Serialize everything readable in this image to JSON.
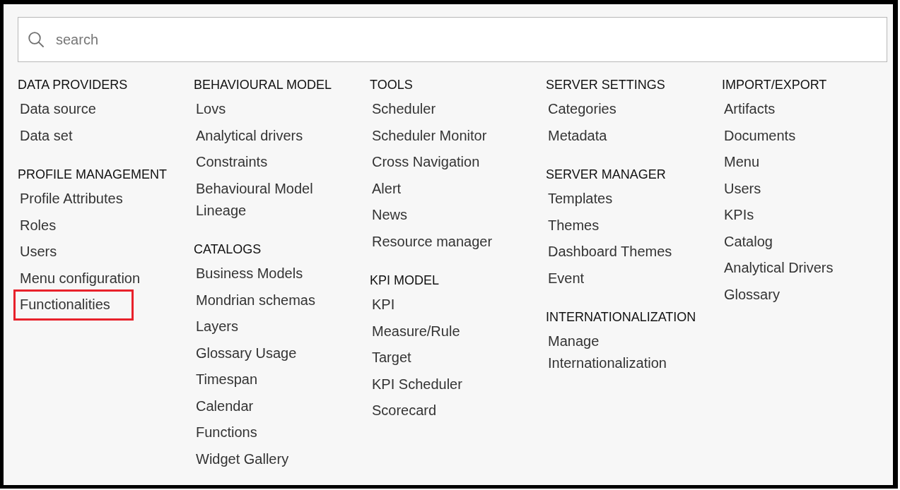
{
  "search": {
    "placeholder": "search"
  },
  "columns": [
    {
      "groups": [
        {
          "title": "DATA PROVIDERS",
          "items": [
            {
              "label": "Data source",
              "highlighted": false
            },
            {
              "label": "Data set",
              "highlighted": false
            }
          ]
        },
        {
          "title": "PROFILE MANAGEMENT",
          "items": [
            {
              "label": "Profile Attributes",
              "highlighted": false
            },
            {
              "label": "Roles",
              "highlighted": false
            },
            {
              "label": "Users",
              "highlighted": false
            },
            {
              "label": "Menu configuration",
              "highlighted": false
            },
            {
              "label": "Functionalities",
              "highlighted": true
            }
          ]
        }
      ]
    },
    {
      "groups": [
        {
          "title": "BEHAVIOURAL MODEL",
          "items": [
            {
              "label": "Lovs",
              "highlighted": false
            },
            {
              "label": "Analytical drivers",
              "highlighted": false
            },
            {
              "label": "Constraints",
              "highlighted": false
            },
            {
              "label": "Behavioural Model Lineage",
              "highlighted": false
            }
          ]
        },
        {
          "title": "CATALOGS",
          "items": [
            {
              "label": "Business Models",
              "highlighted": false
            },
            {
              "label": "Mondrian schemas",
              "highlighted": false
            },
            {
              "label": "Layers",
              "highlighted": false
            },
            {
              "label": "Glossary Usage",
              "highlighted": false
            },
            {
              "label": "Timespan",
              "highlighted": false
            },
            {
              "label": "Calendar",
              "highlighted": false
            },
            {
              "label": "Functions",
              "highlighted": false
            },
            {
              "label": "Widget Gallery",
              "highlighted": false
            }
          ]
        }
      ]
    },
    {
      "groups": [
        {
          "title": "TOOLS",
          "items": [
            {
              "label": "Scheduler",
              "highlighted": false
            },
            {
              "label": "Scheduler Monitor",
              "highlighted": false
            },
            {
              "label": "Cross Navigation",
              "highlighted": false
            },
            {
              "label": "Alert",
              "highlighted": false
            },
            {
              "label": "News",
              "highlighted": false
            },
            {
              "label": "Resource manager",
              "highlighted": false
            }
          ]
        },
        {
          "title": "KPI MODEL",
          "items": [
            {
              "label": "KPI",
              "highlighted": false
            },
            {
              "label": "Measure/Rule",
              "highlighted": false
            },
            {
              "label": "Target",
              "highlighted": false
            },
            {
              "label": "KPI Scheduler",
              "highlighted": false
            },
            {
              "label": "Scorecard",
              "highlighted": false
            }
          ]
        }
      ]
    },
    {
      "groups": [
        {
          "title": "SERVER SETTINGS",
          "items": [
            {
              "label": "Categories",
              "highlighted": false
            },
            {
              "label": "Metadata",
              "highlighted": false
            }
          ]
        },
        {
          "title": "SERVER MANAGER",
          "items": [
            {
              "label": "Templates",
              "highlighted": false
            },
            {
              "label": "Themes",
              "highlighted": false
            },
            {
              "label": "Dashboard Themes",
              "highlighted": false
            },
            {
              "label": "Event",
              "highlighted": false
            }
          ]
        },
        {
          "title": "INTERNATIONALIZATION",
          "items": [
            {
              "label": "Manage Internationalization",
              "highlighted": false
            }
          ]
        }
      ]
    },
    {
      "groups": [
        {
          "title": "IMPORT/EXPORT",
          "items": [
            {
              "label": "Artifacts",
              "highlighted": false
            },
            {
              "label": "Documents",
              "highlighted": false
            },
            {
              "label": "Menu",
              "highlighted": false
            },
            {
              "label": "Users",
              "highlighted": false
            },
            {
              "label": "KPIs",
              "highlighted": false
            },
            {
              "label": "Catalog",
              "highlighted": false
            },
            {
              "label": "Analytical Drivers",
              "highlighted": false
            },
            {
              "label": "Glossary",
              "highlighted": false
            }
          ]
        }
      ]
    }
  ]
}
